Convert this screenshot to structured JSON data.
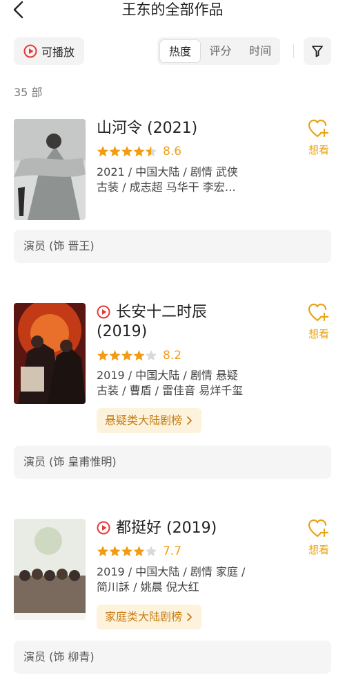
{
  "header": {
    "title": "王东的全部作品",
    "back_icon": "chevron-left-icon"
  },
  "filters": {
    "playable_label": "可播放",
    "sort_tabs": [
      {
        "label": "热度",
        "active": true
      },
      {
        "label": "评分",
        "active": false
      },
      {
        "label": "时间",
        "active": false
      }
    ],
    "filter_icon": "funnel-icon"
  },
  "count_label": "35 部",
  "colors": {
    "accent": "#e8a417",
    "play_red": "#e53935",
    "tag_bg": "#fdf3dd",
    "tag_text": "#c87c12"
  },
  "movies": [
    {
      "title": "山河令 (2021)",
      "playable": false,
      "rating_stars": 4.5,
      "score": "8.6",
      "meta_line1": "2021 / 中国大陆 / 剧情 武侠",
      "meta_line2": "古装 / 成志超 马华干 李宏…",
      "chart_tag": "",
      "want_label": "想看",
      "role": "演员 (饰 晋王)"
    },
    {
      "title": "长安十二时辰",
      "title_line2": "(2019)",
      "playable": true,
      "rating_stars": 4,
      "score": "8.2",
      "meta_line1": "2019 / 中国大陆 / 剧情 悬疑",
      "meta_line2": "古装 / 曹盾 / 雷佳音 易烊千玺",
      "chart_tag": "悬疑类大陆剧榜",
      "want_label": "想看",
      "role": "演员 (饰 皇甫惟明)"
    },
    {
      "title": "都挺好 (2019)",
      "playable": true,
      "rating_stars": 4,
      "score": "7.7",
      "meta_line1": "2019 / 中国大陆 / 剧情 家庭 /",
      "meta_line2": "简川訸 / 姚晨 倪大红",
      "chart_tag": "家庭类大陆剧榜",
      "want_label": "想看",
      "role": "演员 (饰 柳青)"
    }
  ]
}
